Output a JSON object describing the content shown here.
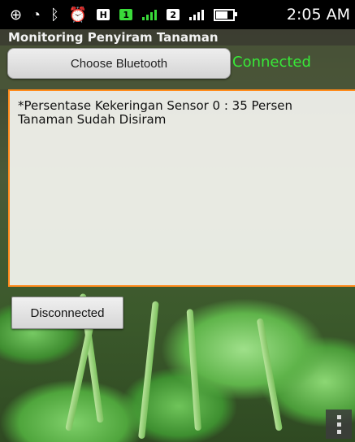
{
  "statusbar": {
    "icons": [
      "plus-icon",
      "wifi-icon",
      "bluetooth-icon",
      "alarm-icon",
      "h-network-icon",
      "sim1-icon",
      "signal1-icon",
      "sim2-icon",
      "signal2-icon",
      "battery-icon"
    ],
    "h_label": "H",
    "sim1_label": "1",
    "sim2_label": "2",
    "time": "2:05 AM"
  },
  "app": {
    "title": "Monitoring Penyiram Tanaman"
  },
  "controls": {
    "choose_label": "Choose Bluetooth",
    "connection_status": "Connected",
    "disconnect_label": "Disconnected"
  },
  "log": {
    "lines": [
      "*Persentase Kekeringan Sensor 0 : 35 Persen",
      "Tanaman Sudah Disiram"
    ]
  },
  "colors": {
    "accent_border": "#ff8a1a",
    "connected_text": "#38e838",
    "statusbar_bg": "#000000"
  }
}
